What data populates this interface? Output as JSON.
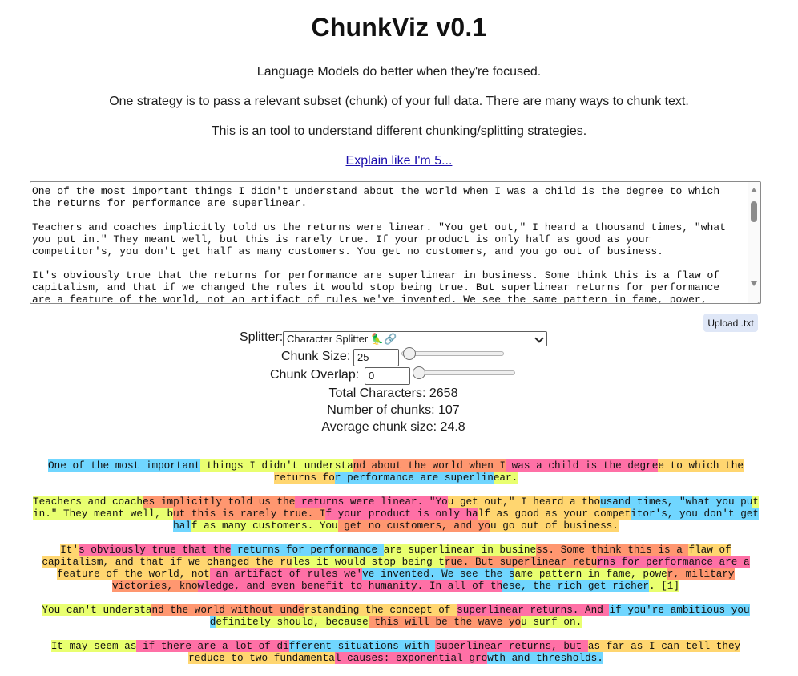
{
  "title": "ChunkViz v0.1",
  "intro": {
    "line1": "Language Models do better when they're focused.",
    "line2": "One strategy is to pass a relevant subset (chunk) of your full data. There are many ways to chunk text.",
    "line3": "This is an tool to understand different chunking/splitting strategies.",
    "eli5_link": "Explain like I'm 5..."
  },
  "editor": {
    "text": "One of the most important things I didn't understand about the world when I was a child is the degree to which the returns for performance are superlinear.\n\nTeachers and coaches implicitly told us the returns were linear. \"You get out,\" I heard a thousand times, \"what you put in.\" They meant well, but this is rarely true. If your product is only half as good as your competitor's, you don't get half as many customers. You get no customers, and you go out of business.\n\nIt's obviously true that the returns for performance are superlinear in business. Some think this is a flaw of capitalism, and that if we changed the rules it would stop being true. But superlinear returns for performance are a feature of the world, not an artifact of rules we've invented. We see the same pattern in fame, power, military"
  },
  "upload_label": "Upload .txt",
  "controls": {
    "splitter_label": "Splitter:",
    "splitter_value": "Character Splitter 🦜🔗",
    "chunk_size_label": "Chunk Size:",
    "chunk_size_value": "25",
    "chunk_size_slider_fraction": 0.02,
    "chunk_overlap_label": "Chunk Overlap:",
    "chunk_overlap_value": "0",
    "chunk_overlap_slider_fraction": 0.0
  },
  "stats": {
    "total_characters": "Total Characters: 2658",
    "number_of_chunks": "Number of chunks: 107",
    "average_chunk_size": "Average chunk size: 24.8"
  },
  "chunk_colors": [
    "#70d6ff",
    "#e9ff70",
    "#ff9770",
    "#ff70a6",
    "#ffd670"
  ],
  "paragraphs": [
    [
      {
        "text": "One of the most important",
        "c": 0
      },
      {
        "text": " things I didn't understa",
        "c": 1
      },
      {
        "text": "nd about the world when I",
        "c": 2
      },
      {
        "text": " was a child is the degre",
        "c": 3
      },
      {
        "text": "e to which the returns fo",
        "c": 4
      },
      {
        "text": "r ",
        "c": 0
      },
      {
        "text": "performance are superlin",
        "c": 0
      },
      {
        "text": "ear.",
        "c": 1
      }
    ],
    [
      {
        "text": "Teachers and coach",
        "c": 1
      },
      {
        "text": "es implicitly told us the",
        "c": 2
      },
      {
        "text": " returns were linear. \"Yo",
        "c": 3
      },
      {
        "text": "u get out,\" I heard a tho",
        "c": 4
      },
      {
        "text": "usand times, \"what you pu",
        "c": 0
      },
      {
        "text": "t in.\"",
        "c": 1
      },
      {
        "text": " They meant well, b",
        "c": 1
      },
      {
        "text": "ut this is rarely true. I",
        "c": 2
      },
      {
        "text": "f your product is only ha",
        "c": 3
      },
      {
        "text": "lf as good as your compet",
        "c": 4
      },
      {
        "text": "itor's, you don't get hal",
        "c": 0
      },
      {
        "text": "f as many",
        "c": 1
      },
      {
        "text": " customers. You",
        "c": 1
      },
      {
        "text": " get no customers, and yo",
        "c": 2
      },
      {
        "text": "u go out of business.",
        "c": 4
      }
    ],
    [
      {
        "text": "It'",
        "c": 4
      },
      {
        "text": "s obviously true that the",
        "c": 3
      },
      {
        "text": " returns for performance ",
        "c": 0
      },
      {
        "text": "are superlinear in busine",
        "c": 1
      },
      {
        "text": "ss. Some think this is a ",
        "c": 2
      },
      {
        "text": "flaw of capitalism, and",
        "c": 4
      },
      {
        "text": " that if we changed the ru",
        "c": 4
      },
      {
        "text": "les it would stop being t",
        "c": 1
      },
      {
        "text": "rue. But superlinear retu",
        "c": 2
      },
      {
        "text": "rns for performance are a",
        "c": 3
      },
      {
        "text": " feature of the world, not",
        "c": 4
      },
      {
        "text": " an artifact of rules we'",
        "c": 3
      },
      {
        "text": "ve invented. We see the s",
        "c": 0
      },
      {
        "text": "ame pattern in fame, powe",
        "c": 1
      },
      {
        "text": "r, military victories, kno",
        "c": 2
      },
      {
        "text": "wledge, and even benefit ",
        "c": 3
      },
      {
        "text": "to",
        "c": 3
      },
      {
        "text": " humanity. In all of th",
        "c": 3
      },
      {
        "text": "ese, the rich get richer",
        "c": 0
      },
      {
        "text": ". [1]",
        "c": 1
      }
    ],
    [
      {
        "text": "You can't understa",
        "c": 1
      },
      {
        "text": "nd the world without unde",
        "c": 2
      },
      {
        "text": "rstanding the concept of ",
        "c": 4
      },
      {
        "text": "superlinear returns. And ",
        "c": 3
      },
      {
        "text": "if you're ambitious you d",
        "c": 0
      },
      {
        "text": "efinitely",
        "c": 1
      },
      {
        "text": " should, because",
        "c": 1
      },
      {
        "text": " this will be the wave yo",
        "c": 2
      },
      {
        "text": "u surf on.",
        "c": 1
      }
    ],
    [
      {
        "text": "It may seem as",
        "c": 1
      },
      {
        "text": " if there are a lot of di",
        "c": 3
      },
      {
        "text": "fferent situations with ",
        "c": 0
      },
      {
        "text": "superlinear returns, but ",
        "c": 3
      },
      {
        "text": "as far as I can tell they",
        "c": 4
      },
      {
        "text": " reduce to two",
        "c": 4
      },
      {
        "text": " fundamenta",
        "c": 4
      },
      {
        "text": "l causes: exponential gro",
        "c": 3
      },
      {
        "text": "wth and thresholds.",
        "c": 0
      }
    ]
  ]
}
